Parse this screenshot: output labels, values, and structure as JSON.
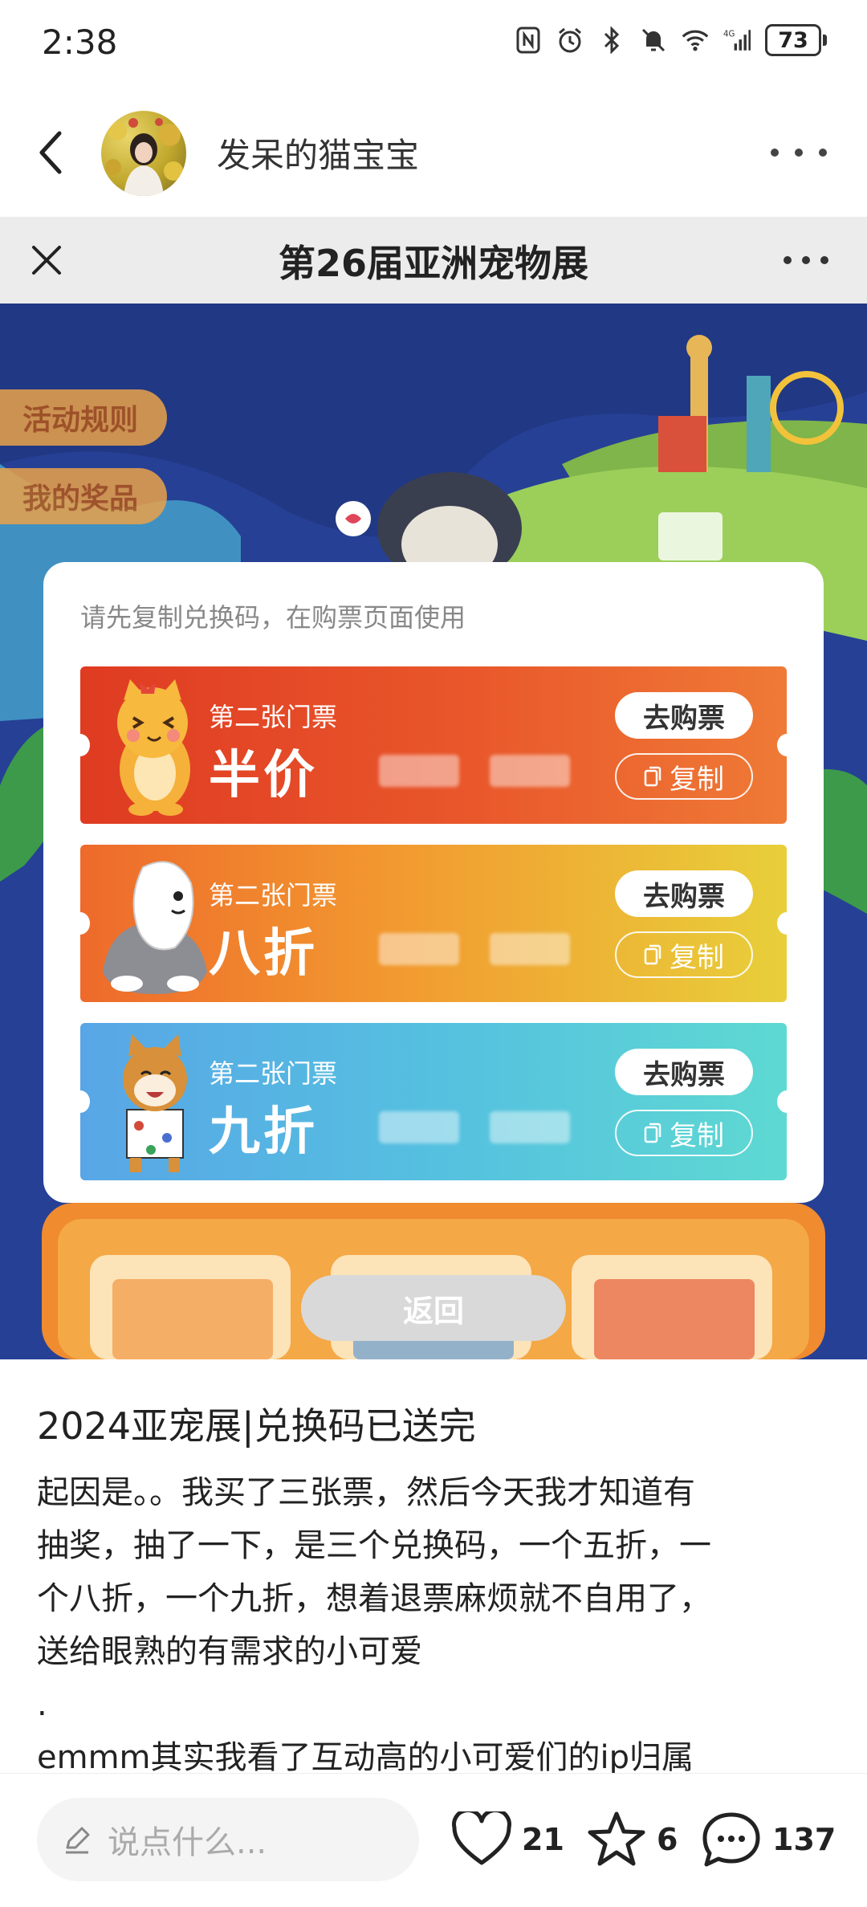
{
  "status_bar": {
    "time": "2:38",
    "battery": "73"
  },
  "post_header": {
    "author": "发呆的猫宝宝"
  },
  "mini_program": {
    "title": "第26届亚洲宠物展",
    "side_buttons": [
      "活动规则",
      "我的奖品"
    ],
    "hint": "请先复制兑换码，在购票页面使用",
    "coupons": [
      {
        "label": "第二张门票",
        "discount": "半价",
        "buy_label": "去购票",
        "copy_label": "复制"
      },
      {
        "label": "第二张门票",
        "discount": "八折",
        "buy_label": "去购票",
        "copy_label": "复制"
      },
      {
        "label": "第二张门票",
        "discount": "九折",
        "buy_label": "去购票",
        "copy_label": "复制"
      }
    ],
    "return_label": "返回"
  },
  "post": {
    "title": "2024亚宠展|兑换码已送完",
    "body_lines": [
      "起因是。。我买了三张票，然后今天我才知道有",
      "抽奖，抽了一下，是三个兑换码，一个五折，一",
      "个八折，一个九折，想着退票麻烦就不自用了，",
      "送给眼熟的有需求的小可爱",
      ".",
      "emmm其实我看了互动高的小可爱们的ip归属"
    ]
  },
  "bottom_bar": {
    "comment_placeholder": "说点什么...",
    "likes": "21",
    "favorites": "6",
    "comments": "137"
  },
  "colors": {
    "coupon1": "#e24a26",
    "coupon2": "#f0a030",
    "coupon3": "#58b8e2",
    "scene_bg": "#213884"
  }
}
